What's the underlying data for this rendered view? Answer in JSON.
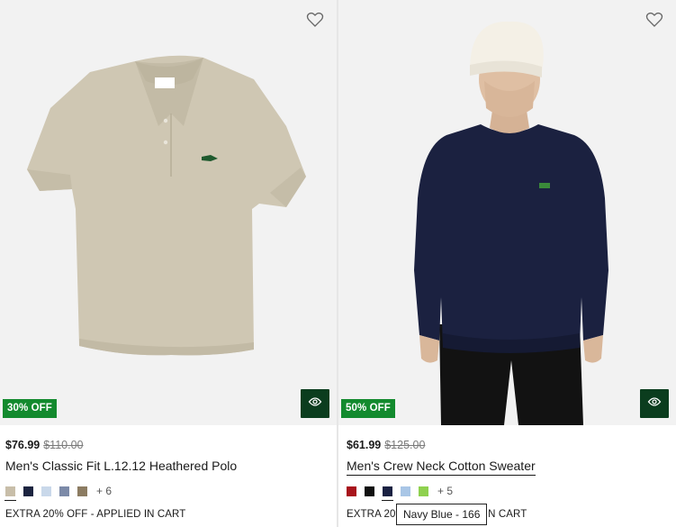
{
  "products": [
    {
      "badge": "30% OFF",
      "price_now": "$76.99",
      "price_was": "$110.00",
      "name": "Men's Classic Fit L.12.12 Heathered Polo",
      "swatches": [
        "#c8bea9",
        "#1c2440",
        "#c9d8ea",
        "#7c8aa8",
        "#8c7c62"
      ],
      "more_colors": "+ 6",
      "promo": "EXTRA 20% OFF - APPLIED IN CART",
      "icons": [
        "heart-icon",
        "quick-view-icon"
      ]
    },
    {
      "badge": "50% OFF",
      "price_now": "$61.99",
      "price_was": "$125.00",
      "name": "Men's Crew Neck Cotton Sweater",
      "swatches": [
        "#a8141c",
        "#111111",
        "#1a2142",
        "#a9c6e6",
        "#8fd14f"
      ],
      "more_colors": "+ 5",
      "promo": "EXTRA 20% OFF - APPLIED IN CART",
      "tooltip": "Navy Blue - 166",
      "icons": [
        "heart-icon",
        "quick-view-icon"
      ]
    }
  ],
  "colors": {
    "badge_green": "#138a2e",
    "quickview_green": "#0b3d1e",
    "media_bg": "#f2f2f2"
  }
}
